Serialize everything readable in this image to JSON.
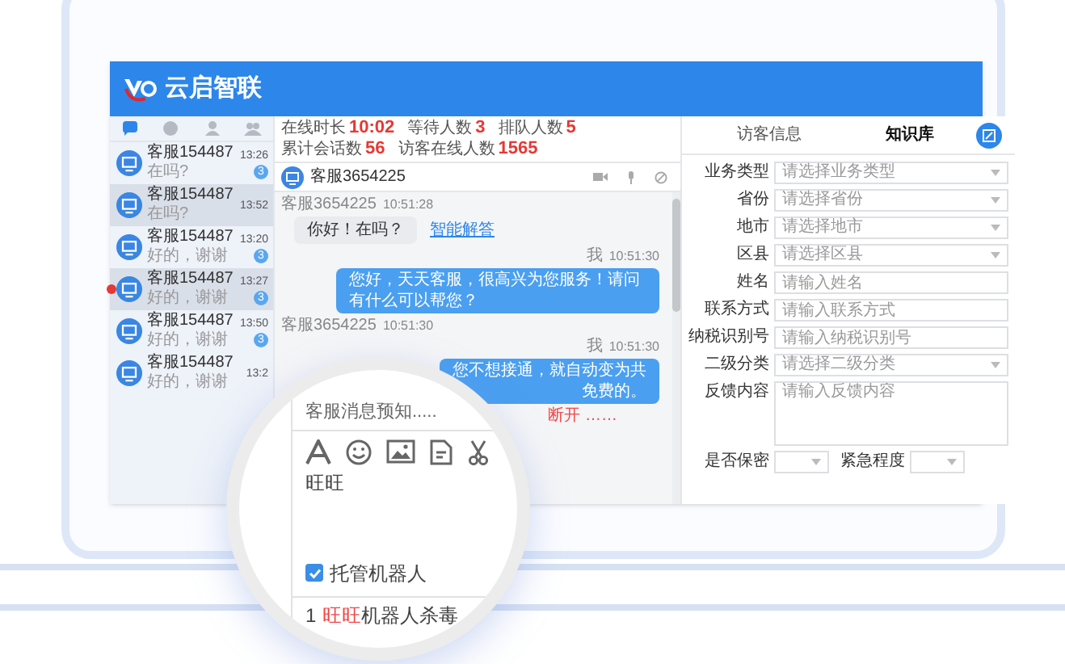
{
  "app": {
    "logo_text": "云启智联"
  },
  "sidebar": {
    "tabs": [
      {
        "selected": true
      },
      {
        "selected": false
      },
      {
        "selected": false
      },
      {
        "selected": false
      }
    ],
    "sessions": [
      {
        "name": "客服154487",
        "preview": "在吗?",
        "time": "13:26",
        "badge": "3",
        "selected": false,
        "alert": false
      },
      {
        "name": "客服154487",
        "preview": "在吗?",
        "time": "13:52",
        "selected": true,
        "alert": false
      },
      {
        "name": "客服154487",
        "preview": "好的，谢谢",
        "time": "13:20",
        "badge": "3",
        "selected": false,
        "alert": false
      },
      {
        "name": "客服154487",
        "preview": "好的，谢谢",
        "time": "13:27",
        "badge": "3",
        "selected": true,
        "alert": true
      },
      {
        "name": "客服154487",
        "preview": "好的，谢谢",
        "time": "13:50",
        "badge": "3",
        "selected": false,
        "alert": false
      },
      {
        "name": "客服154487",
        "preview": "好的，谢谢",
        "time": "13:2",
        "selected": false,
        "alert": false
      }
    ]
  },
  "stats": [
    {
      "label": "在线时长",
      "value": "10:02"
    },
    {
      "label": "等待人数",
      "value": "3"
    },
    {
      "label": "排队人数",
      "value": "5"
    },
    {
      "label": "累计会话数",
      "value": "56"
    },
    {
      "label": "访客在线人数",
      "value": "1565"
    }
  ],
  "chat": {
    "title": "客服3654225",
    "messages": [
      {
        "kind": "meta_in",
        "sender": "客服3654225",
        "time": "10:51:28"
      },
      {
        "kind": "incoming",
        "text": "你好！在吗？",
        "link": "智能解答"
      },
      {
        "kind": "meta_out",
        "sender": "我",
        "time": "10:51:30"
      },
      {
        "kind": "outgoing",
        "lines": [
          "您好，天天客服，很高兴为您服务！请问有什么可以帮您？"
        ]
      },
      {
        "kind": "meta_in",
        "sender": "客服3654225",
        "time": "10:51:30"
      },
      {
        "kind": "meta_out",
        "sender": "我",
        "time": "10:51:30"
      },
      {
        "kind": "outgoing",
        "lines": [
          "您不想接通，就自动变为共",
          "免费的。"
        ]
      },
      {
        "kind": "system",
        "text": "断开 ……"
      }
    ]
  },
  "composer": {
    "placeholder": "客服消息预知.....",
    "value": "旺旺",
    "robot": {
      "label": "托管机器人",
      "checked": true
    },
    "suggestion": {
      "index": "1",
      "keyword": "旺旺",
      "rest": "机器人杀毒"
    }
  },
  "panel": {
    "tabs": [
      {
        "label": "访客信息",
        "selected": false
      },
      {
        "label": "知识库",
        "selected": true
      }
    ],
    "fields": [
      {
        "label": "业务类型",
        "kind": "select",
        "placeholder": "请选择业务类型"
      },
      {
        "label": "省份",
        "kind": "select",
        "placeholder": "请选择省份"
      },
      {
        "label": "地市",
        "kind": "select",
        "placeholder": "请选择地市"
      },
      {
        "label": "区县",
        "kind": "select",
        "placeholder": "请选择区县"
      },
      {
        "label": "姓名",
        "kind": "input",
        "placeholder": "请输入姓名"
      },
      {
        "label": "联系方式",
        "kind": "input",
        "placeholder": "请输入联系方式"
      },
      {
        "label": "纳税识别号",
        "kind": "input",
        "placeholder": "请输入纳税识别号"
      },
      {
        "label": "二级分类",
        "kind": "select",
        "placeholder": "请选择二级分类"
      },
      {
        "label": "反馈内容",
        "kind": "textarea",
        "placeholder": "请输入反馈内容"
      }
    ],
    "bottom_fields": [
      {
        "label": "是否保密"
      },
      {
        "label": "紧急程度"
      }
    ]
  }
}
